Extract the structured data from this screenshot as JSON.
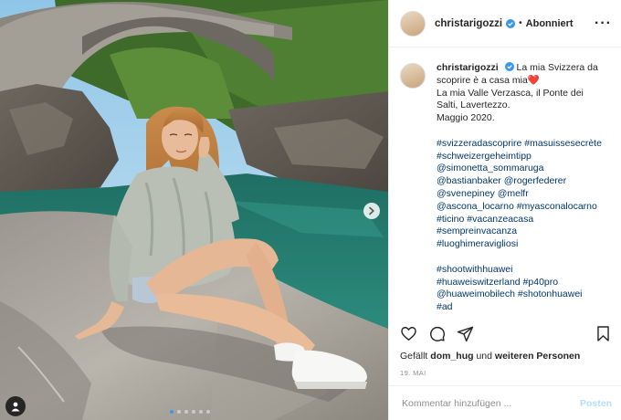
{
  "header": {
    "username": "christarigozzi",
    "separator": "•",
    "follow_status": "Abonniert",
    "more": "···"
  },
  "caption": {
    "username": "christarigozzi",
    "text_lines": [
      "La mia Svizzera da",
      "scoprire è a casa mia❤️",
      "La mia Valle Verzasca, il Ponte dei",
      "Salti, Lavertezzo.",
      "Maggio 2020."
    ],
    "hashtags_1": [
      "#svizzeradascoprire #masuissesecrète",
      "#schweizergeheimtipp",
      "@simonetta_sommaruga",
      "@bastianbaker @rogerfederer",
      "@svenepiney @melfr",
      "@ascona_locarno #myasconalocarno",
      "#ticino #vacanzeacasa",
      "#sempreinvacanza",
      "#luoghimeravigliosi"
    ],
    "hashtags_2": [
      "#shootwithhuawei",
      "#huaweiswitzerland #p40pro",
      "@huaweimobilech #shotonhuawei",
      "#ad"
    ]
  },
  "likes": {
    "prefix": "Gefällt",
    "user": "dom_hug",
    "middle": "und",
    "suffix": "weiteren Personen"
  },
  "date": "19. MAI",
  "comment": {
    "placeholder": "Kommentar hinzufügen ...",
    "post_label": "Posten"
  },
  "colors": {
    "verified": "#3897f0",
    "link": "#00376b",
    "post_button": "#b2dffc",
    "active_dot": "#3897f0"
  },
  "icons": [
    "heart-icon",
    "comment-icon",
    "share-icon",
    "bookmark-icon",
    "verified-icon",
    "chevron-right-icon",
    "person-icon"
  ],
  "carousel": {
    "slides": 6,
    "active": 1
  }
}
